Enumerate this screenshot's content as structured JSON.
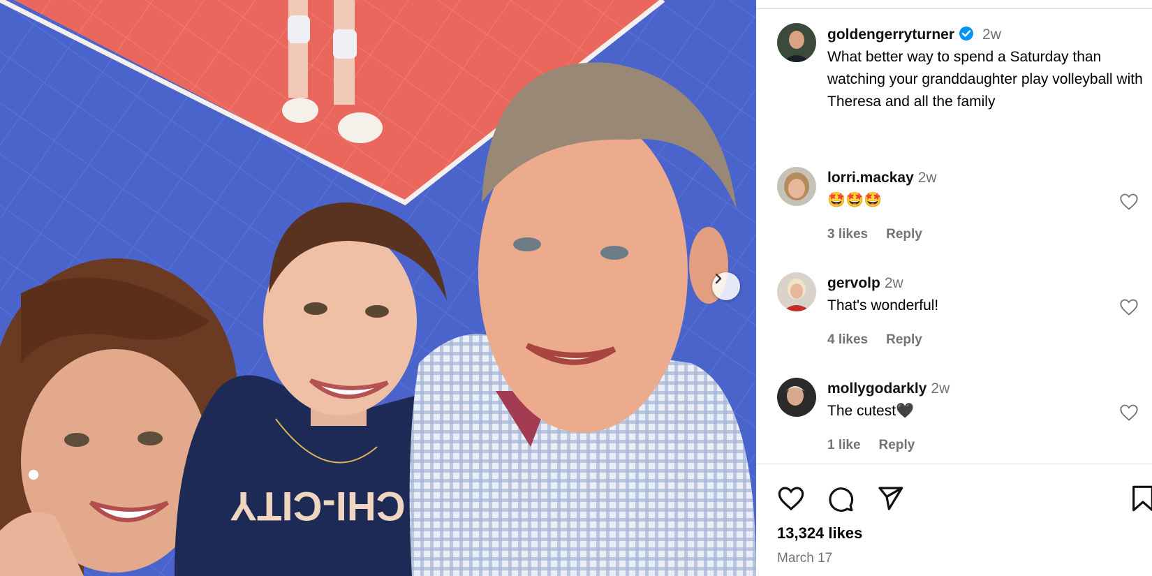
{
  "post": {
    "author": "goldengerryturner",
    "time": "2w",
    "caption": "What better way to spend a Saturday than watching your granddaughter play volleyball with Theresa and all the family",
    "likes": "13,324 likes",
    "date": "March 17",
    "photo_text": "CHI-CITY"
  },
  "comments": [
    {
      "user": "lorri.mackay",
      "time": "2w",
      "text": "🤩🤩🤩",
      "likes": "3 likes",
      "reply": "Reply"
    },
    {
      "user": "gervolp",
      "time": "2w",
      "text": "That's wonderful!",
      "likes": "4 likes",
      "reply": "Reply"
    },
    {
      "user": "mollygodarkly",
      "time": "2w",
      "text": "The cutest🖤",
      "likes": "1 like",
      "reply": "Reply"
    }
  ],
  "icons": {
    "like": "heart-icon",
    "comment": "comment-icon",
    "share": "share-icon",
    "save": "bookmark-icon",
    "next": "chevron-right-icon",
    "verified": "verified-badge-icon"
  },
  "colors": {
    "court_blue": "#4a63c9",
    "court_red": "#e8645a",
    "verified_blue": "#0095f6",
    "muted_text": "#737373",
    "divider": "#dbdbdb"
  }
}
